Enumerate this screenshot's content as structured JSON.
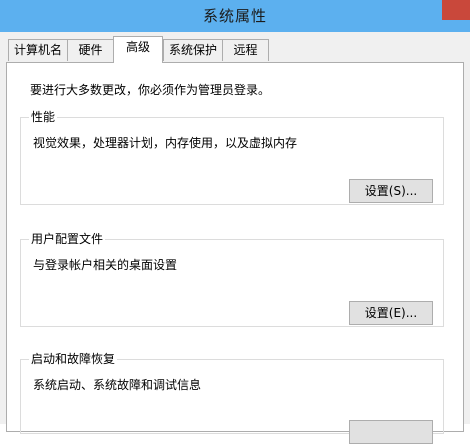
{
  "window": {
    "title": "系统属性"
  },
  "tabs": [
    "计算机名",
    "硬件",
    "高级",
    "系统保护",
    "远程"
  ],
  "active_tab": "高级",
  "notice": "要进行大多数更改，你必须作为管理员登录。",
  "performance": {
    "title": "性能",
    "description": "视觉效果，处理器计划，内存使用，以及虚拟内存",
    "button": "设置(S)..."
  },
  "user_profiles": {
    "title": "用户配置文件",
    "description": "与登录帐户相关的桌面设置",
    "button": "设置(E)..."
  },
  "startup_recovery": {
    "title": "启动和故障恢复",
    "description": "系统启动、系统故障和调试信息"
  },
  "colors": {
    "titlebar": "#5cb0ef",
    "close_button": "#c9483b",
    "dialog_background": "#f0f0f0",
    "panel_background": "#ffffff"
  }
}
